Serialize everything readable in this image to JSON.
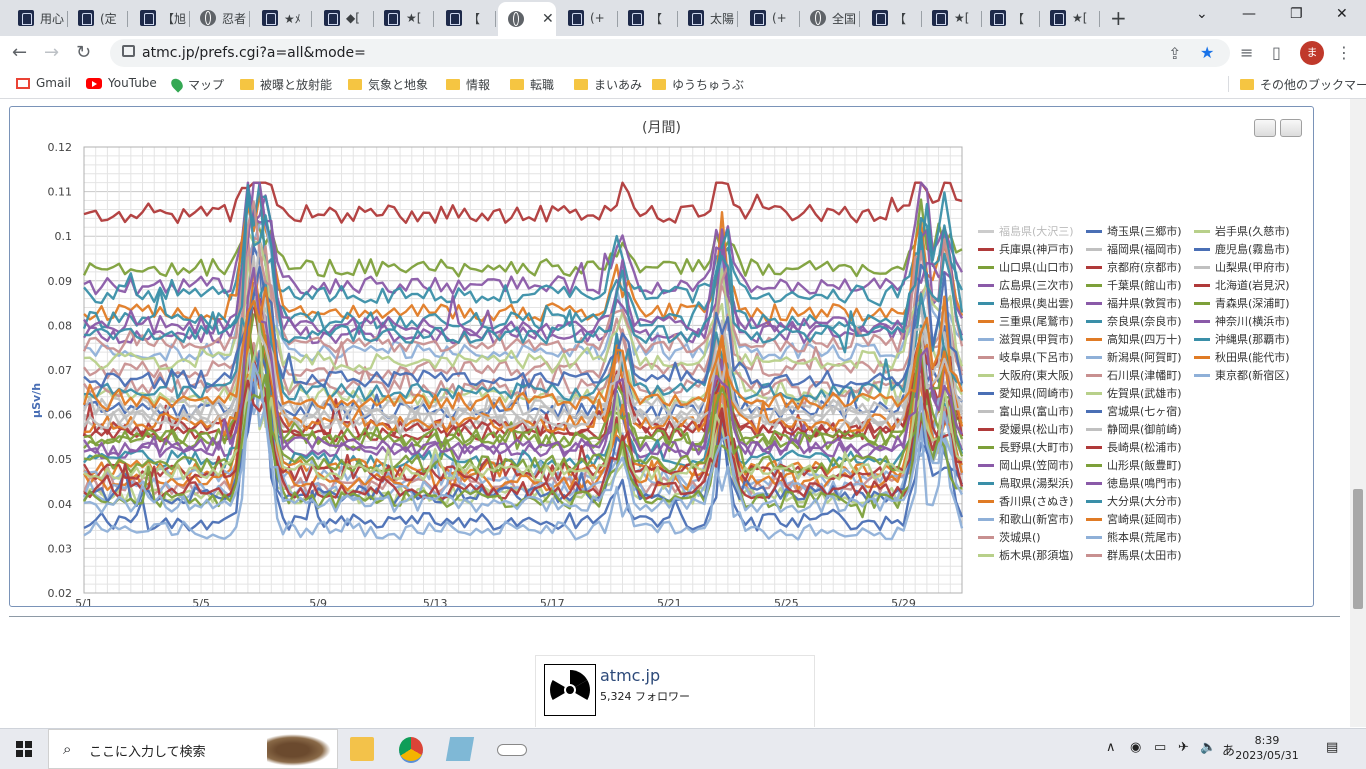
{
  "browser": {
    "tabs": [
      {
        "title": "用心",
        "icon": "site-favicon-icon"
      },
      {
        "title": "(定",
        "icon": "site-favicon-icon"
      },
      {
        "title": "【旭",
        "icon": "site-favicon-icon"
      },
      {
        "title": "忍者",
        "icon": "globe-icon"
      },
      {
        "title": "★ﾒ",
        "icon": "site-favicon-icon"
      },
      {
        "title": "◆[",
        "icon": "site-favicon-icon"
      },
      {
        "title": "★[",
        "icon": "site-favicon-icon"
      },
      {
        "title": "【",
        "icon": "site-favicon-icon"
      },
      {
        "title": "",
        "icon": "globe-icon",
        "active": true
      },
      {
        "title": "(+",
        "icon": "site-favicon-icon"
      },
      {
        "title": "【",
        "icon": "site-favicon-icon"
      },
      {
        "title": "太陽",
        "icon": "site-favicon-icon"
      },
      {
        "title": "(+",
        "icon": "site-favicon-icon"
      },
      {
        "title": "全国",
        "icon": "globe-icon"
      },
      {
        "title": "【",
        "icon": "site-favicon-icon"
      },
      {
        "title": "★[",
        "icon": "site-favicon-icon"
      },
      {
        "title": "【",
        "icon": "site-favicon-icon"
      },
      {
        "title": "★[",
        "icon": "site-favicon-icon"
      }
    ],
    "new_tab": "+",
    "url": "atmc.jp/prefs.cgi?a=all&mode=",
    "avatar_letter": "ま",
    "bookmarks": [
      {
        "label": "Gmail",
        "icon": "gmail-icon"
      },
      {
        "label": "YouTube",
        "icon": "youtube-icon"
      },
      {
        "label": "マップ",
        "icon": "maps-icon"
      },
      {
        "label": "被曝と放射能",
        "icon": "folder-icon"
      },
      {
        "label": "気象と地象",
        "icon": "folder-icon"
      },
      {
        "label": "情報",
        "icon": "folder-icon"
      },
      {
        "label": "転職",
        "icon": "folder-icon"
      },
      {
        "label": "まいあみ",
        "icon": "folder-icon"
      },
      {
        "label": "ゆうちゅうぶ",
        "icon": "folder-icon"
      }
    ],
    "other_bookmarks": "その他のブックマーク"
  },
  "colors": {
    "tab_strip": "#dee1e6",
    "chart_border": "#7a93b8",
    "palette": [
      "#c0c0c0",
      "#b03a3a",
      "#7da03a",
      "#8a5aa8",
      "#3a8fa8",
      "#e07b25",
      "#8fb0d8",
      "#c89090",
      "#b8d08a",
      "#4a6fb5"
    ]
  },
  "chart_data": {
    "type": "line",
    "title": "(月間)",
    "ylabel": "μSv/h",
    "xlabel": "",
    "ylim": [
      0.02,
      0.12
    ],
    "yticks": [
      "0.02",
      "0.03",
      "0.04",
      "0.05",
      "0.06",
      "0.07",
      "0.08",
      "0.09",
      "0.1",
      "0.11",
      "0.12"
    ],
    "xticks": [
      "5/1",
      "5/5",
      "5/9",
      "5/13",
      "5/17",
      "5/21",
      "5/25",
      "5/29"
    ],
    "x_range_days": [
      1,
      31
    ],
    "grid": true,
    "legend": "right",
    "series": [
      {
        "name": "福島県(大沢三)",
        "base": null,
        "hidden": true
      },
      {
        "name": "兵庫県(神戸市)",
        "base": 0.105
      },
      {
        "name": "山口県(山口市)",
        "base": 0.093
      },
      {
        "name": "広島県(三次市)",
        "base": 0.089
      },
      {
        "name": "島根県(奥出雲)",
        "base": 0.087
      },
      {
        "name": "三重県(尾鷲市)",
        "base": 0.083
      },
      {
        "name": "滋賀県(甲賀市)",
        "base": 0.074
      },
      {
        "name": "岐阜県(下呂市)",
        "base": 0.07
      },
      {
        "name": "大阪府(東大阪)",
        "base": 0.064
      },
      {
        "name": "愛知県(岡崎市)",
        "base": 0.061
      },
      {
        "name": "富山県(富山市)",
        "base": 0.058
      },
      {
        "name": "愛媛県(松山市)",
        "base": 0.056
      },
      {
        "name": "長野県(大町市)",
        "base": 0.054
      },
      {
        "name": "岡山県(笠岡市)",
        "base": 0.052
      },
      {
        "name": "鳥取県(湯梨浜)",
        "base": 0.05
      },
      {
        "name": "香川県(さぬき)",
        "base": 0.048
      },
      {
        "name": "和歌山(新宮市)",
        "base": 0.046
      },
      {
        "name": "茨城県()",
        "base": 0.044
      },
      {
        "name": "栃木県(那須塩)",
        "base": 0.042
      },
      {
        "name": "埼玉県(三郷市)",
        "base": 0.036
      },
      {
        "name": "福岡県(福岡市)",
        "base": 0.06
      },
      {
        "name": "京都府(京都市)",
        "base": 0.057
      },
      {
        "name": "千葉県(館山市)",
        "base": 0.055
      },
      {
        "name": "福井県(敦賀市)",
        "base": 0.078
      },
      {
        "name": "奈良県(奈良市)",
        "base": 0.081
      },
      {
        "name": "高知県(四万十)",
        "base": 0.045
      },
      {
        "name": "新潟県(阿賀町)",
        "base": 0.043
      },
      {
        "name": "石川県(津幡町)",
        "base": 0.066
      },
      {
        "name": "佐賀県(武雄市)",
        "base": 0.072
      },
      {
        "name": "宮城県(七ヶ宿)",
        "base": 0.042
      },
      {
        "name": "静岡県(御前崎)",
        "base": 0.062
      },
      {
        "name": "長崎県(松浦市)",
        "base": 0.047
      },
      {
        "name": "山形県(飯豊町)",
        "base": 0.049
      },
      {
        "name": "徳島県(鳴門市)",
        "base": 0.08
      },
      {
        "name": "大分県(大分市)",
        "base": 0.065
      },
      {
        "name": "宮崎県(延岡市)",
        "base": 0.058
      },
      {
        "name": "熊本県(荒尾市)",
        "base": 0.034
      },
      {
        "name": "群馬県(太田市)",
        "base": 0.076
      },
      {
        "name": "岩手県(久慈市)",
        "base": 0.047
      },
      {
        "name": "鹿児島(霧島市)",
        "base": 0.068
      },
      {
        "name": "山梨県(甲府市)",
        "base": 0.059
      },
      {
        "name": "北海道(岩見沢)",
        "base": 0.043
      },
      {
        "name": "青森県(深浦町)",
        "base": 0.041
      },
      {
        "name": "神奈川(横浜市)",
        "base": 0.053
      },
      {
        "name": "沖縄県(那覇市)",
        "base": 0.078
      },
      {
        "name": "秋田県(能代市)",
        "base": 0.063
      },
      {
        "name": "東京都(新宿区)",
        "base": 0.04
      }
    ]
  },
  "widget": {
    "name": "atmc.jp",
    "followers": "5,324 フォロワー"
  },
  "taskbar": {
    "search_placeholder": "ここに入力して検索",
    "time": "8:39",
    "date": "2023/05/31",
    "ime": "あ"
  }
}
